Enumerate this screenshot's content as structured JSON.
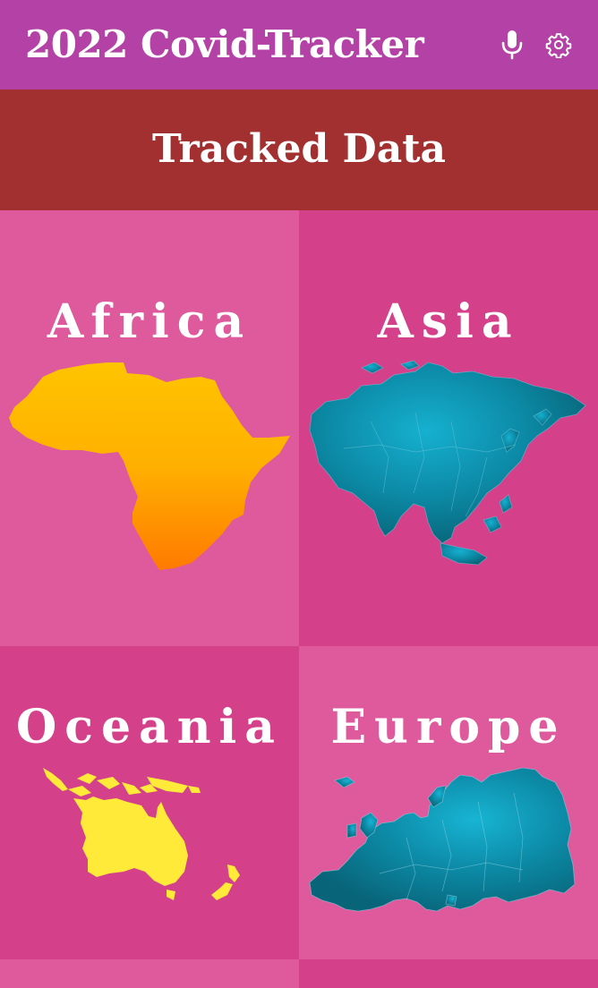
{
  "appbar": {
    "title": "2022 Covid-Tracker",
    "bg_color": "#b441a6",
    "icons": [
      "microphone-icon",
      "gear-icon"
    ]
  },
  "banner": {
    "title": "Tracked Data",
    "bg_color": "#a33031"
  },
  "regions": [
    {
      "label": "Africa",
      "icon": "africa-map-icon",
      "map_colors": [
        "#ffc400",
        "#ff7a00"
      ]
    },
    {
      "label": "Asia",
      "icon": "asia-map-icon",
      "map_colors": [
        "#10a4c4",
        "#0a6e86"
      ]
    },
    {
      "label": "Oceania",
      "icon": "oceania-map-icon",
      "map_colors": [
        "#ffea3a"
      ]
    },
    {
      "label": "Europe",
      "icon": "europe-map-icon",
      "map_colors": [
        "#12a6c6",
        "#0a6e86"
      ]
    }
  ],
  "colors": {
    "tile_light": "#de5a9c",
    "tile_dark": "#d4408a"
  }
}
